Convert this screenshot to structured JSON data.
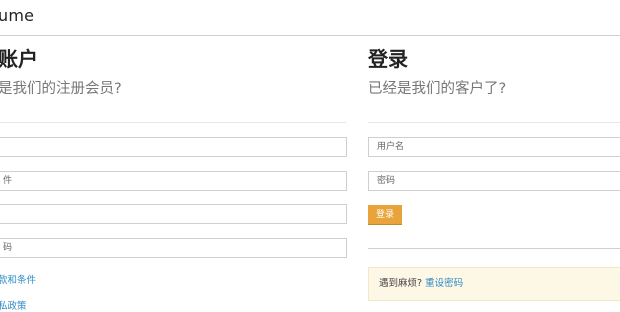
{
  "brand": {
    "name": "ume"
  },
  "register": {
    "title": "账户",
    "subtitle": "是我们的注册会员?",
    "fields": [
      {
        "placeholder": ""
      },
      {
        "placeholder": "件"
      },
      {
        "placeholder": ""
      },
      {
        "placeholder": "码"
      }
    ],
    "links": [
      "款和条件",
      "私政策"
    ]
  },
  "login": {
    "title": "登录",
    "subtitle": "已经是我们的客户了?",
    "fields": [
      {
        "placeholder": "用户名"
      },
      {
        "placeholder": "密码"
      }
    ],
    "button_label": "登录",
    "help_text": "遇到麻烦?",
    "help_link": "重设密码"
  },
  "colors": {
    "accent": "#e8a33b",
    "link": "#2e8bc7",
    "notice_bg": "#fdf7e6"
  }
}
